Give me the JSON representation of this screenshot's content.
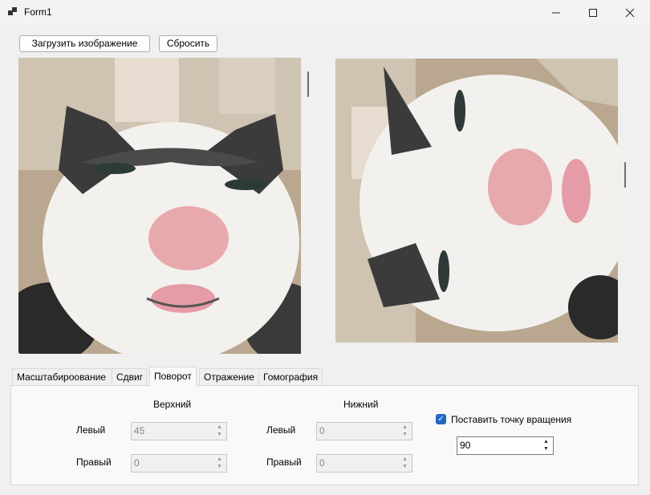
{
  "window": {
    "title": "Form1"
  },
  "toolbar": {
    "load_label": "Загрузить изображение",
    "reset_label": "Сбросить"
  },
  "tabs": [
    {
      "label": "Масштабироование"
    },
    {
      "label": "Сдвиг"
    },
    {
      "label": "Поворот"
    },
    {
      "label": "Отражение"
    },
    {
      "label": "Гомография"
    }
  ],
  "active_tab": "Поворот",
  "panel": {
    "upper_header": "Верхний",
    "lower_header": "Нижний",
    "left_label": "Левый",
    "right_label": "Правый",
    "upper_left_value": "45",
    "upper_right_value": "0",
    "lower_left_value": "0",
    "lower_right_value": "0",
    "pivot_checkbox_label": "Поставить точку вращения",
    "pivot_checked": true,
    "angle_value": "90"
  },
  "colors": {
    "accent": "#1f66c7"
  }
}
